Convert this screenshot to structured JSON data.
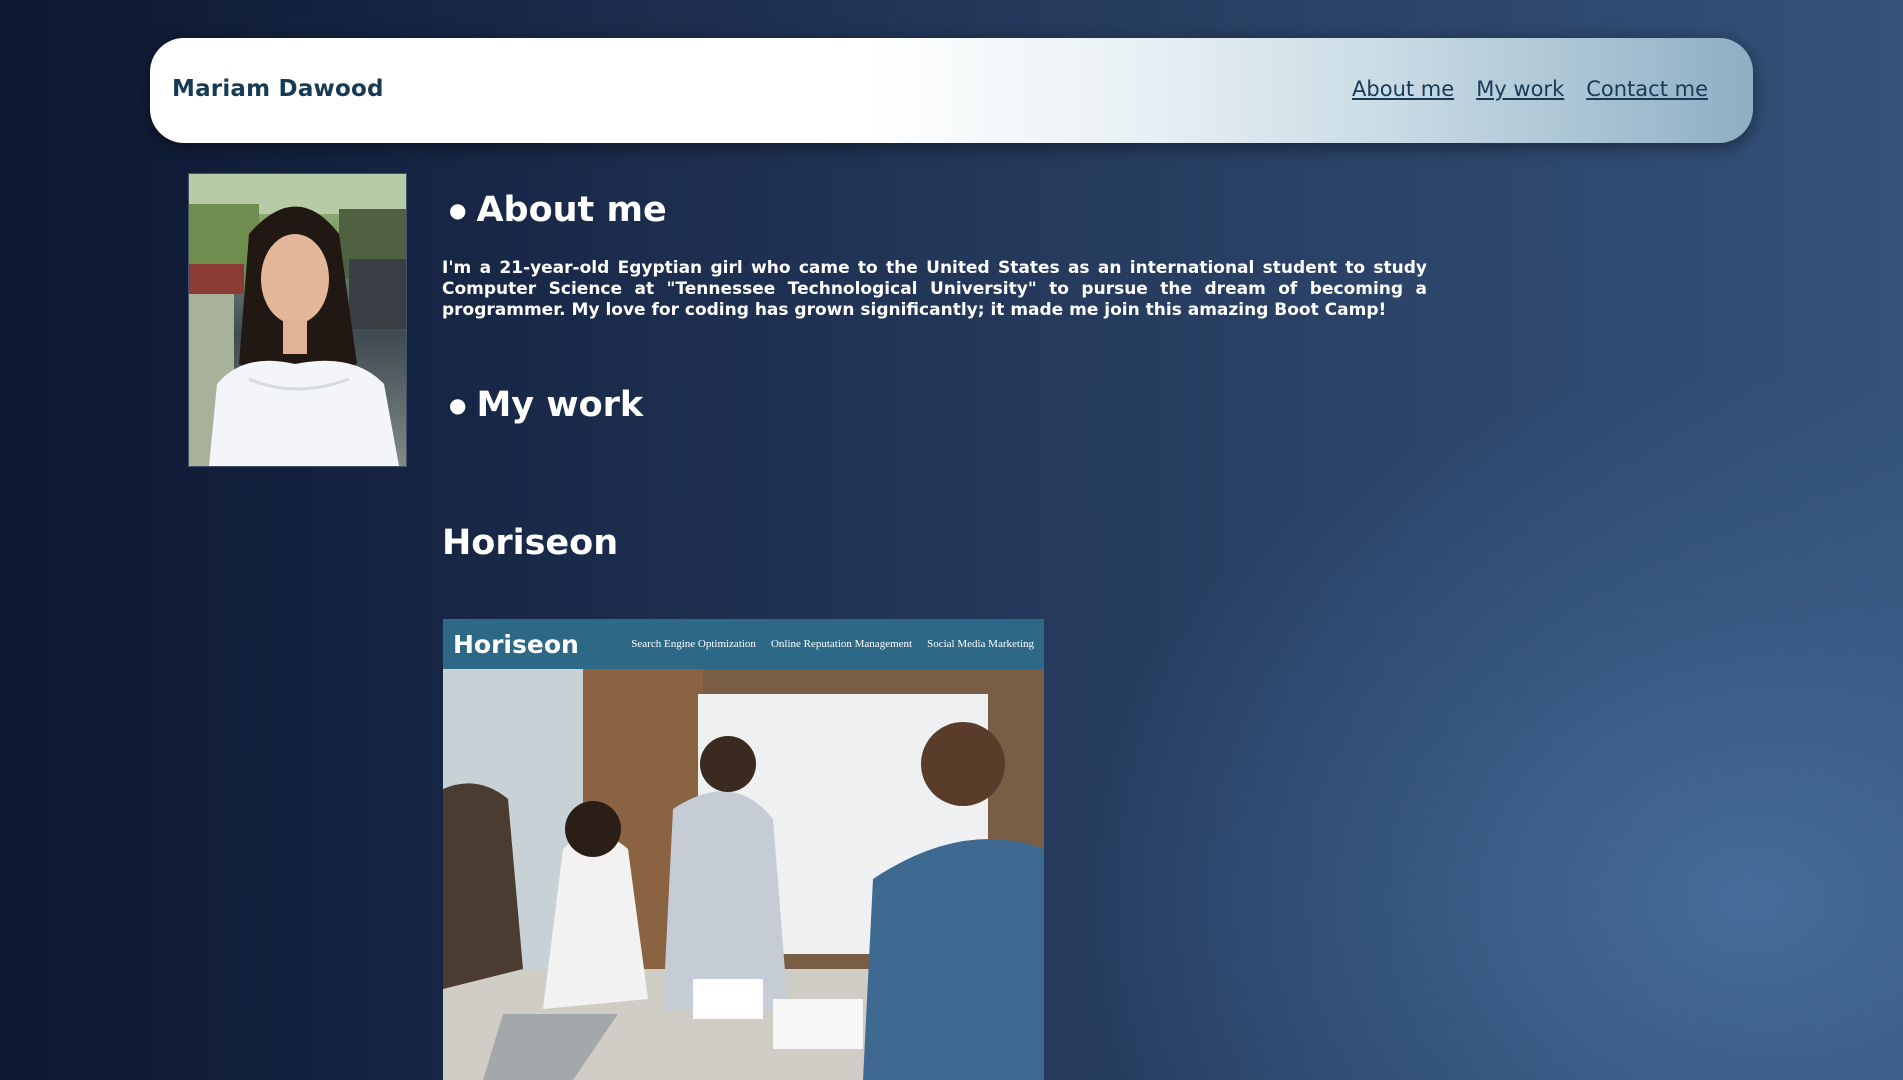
{
  "header": {
    "brand": "Mariam Dawood",
    "nav": [
      "About me",
      "My work",
      "Contact me"
    ]
  },
  "about": {
    "title": "About me",
    "text": "I'm a 21-year-old Egyptian girl who came to the United States as an international student to study Computer Science at \"Tennessee Technological University\" to pursue the dream of becoming a programmer. My love for coding has grown significantly; it made me join this amazing Boot Camp!"
  },
  "work": {
    "title": "My work",
    "project": {
      "title": "Horiseon",
      "logo": "Horiseon",
      "nav": [
        "Search Engine Optimization",
        "Online Reputation Management",
        "Social Media Marketing"
      ]
    }
  },
  "colors": {
    "brand_text": "#173a55",
    "header_bg": "#ffffff",
    "project_bar": "#2d6987"
  },
  "icons": [
    "bullet-icon"
  ]
}
